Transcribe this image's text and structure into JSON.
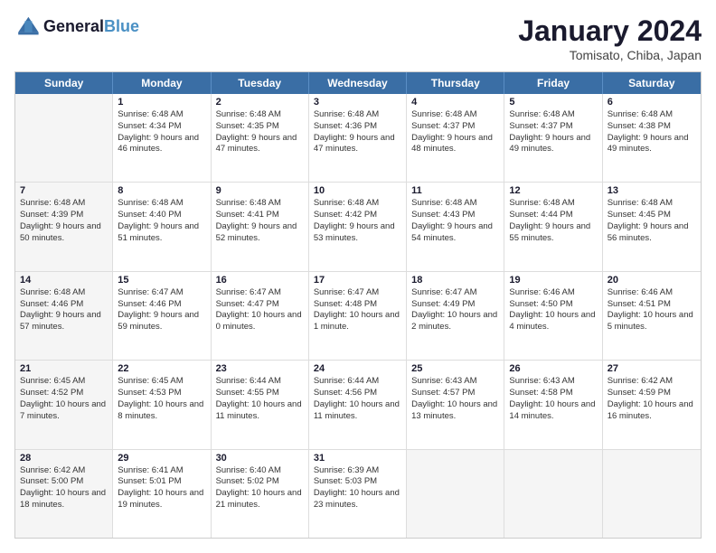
{
  "header": {
    "logo_line1": "General",
    "logo_line2": "Blue",
    "month_year": "January 2024",
    "location": "Tomisato, Chiba, Japan"
  },
  "days_of_week": [
    "Sunday",
    "Monday",
    "Tuesday",
    "Wednesday",
    "Thursday",
    "Friday",
    "Saturday"
  ],
  "weeks": [
    [
      {
        "day": "",
        "sunrise": "",
        "sunset": "",
        "daylight": "",
        "shaded": true
      },
      {
        "day": "1",
        "sunrise": "Sunrise: 6:48 AM",
        "sunset": "Sunset: 4:34 PM",
        "daylight": "Daylight: 9 hours and 46 minutes.",
        "shaded": false
      },
      {
        "day": "2",
        "sunrise": "Sunrise: 6:48 AM",
        "sunset": "Sunset: 4:35 PM",
        "daylight": "Daylight: 9 hours and 47 minutes.",
        "shaded": false
      },
      {
        "day": "3",
        "sunrise": "Sunrise: 6:48 AM",
        "sunset": "Sunset: 4:36 PM",
        "daylight": "Daylight: 9 hours and 47 minutes.",
        "shaded": false
      },
      {
        "day": "4",
        "sunrise": "Sunrise: 6:48 AM",
        "sunset": "Sunset: 4:37 PM",
        "daylight": "Daylight: 9 hours and 48 minutes.",
        "shaded": false
      },
      {
        "day": "5",
        "sunrise": "Sunrise: 6:48 AM",
        "sunset": "Sunset: 4:37 PM",
        "daylight": "Daylight: 9 hours and 49 minutes.",
        "shaded": false
      },
      {
        "day": "6",
        "sunrise": "Sunrise: 6:48 AM",
        "sunset": "Sunset: 4:38 PM",
        "daylight": "Daylight: 9 hours and 49 minutes.",
        "shaded": false
      }
    ],
    [
      {
        "day": "7",
        "sunrise": "Sunrise: 6:48 AM",
        "sunset": "Sunset: 4:39 PM",
        "daylight": "Daylight: 9 hours and 50 minutes.",
        "shaded": true
      },
      {
        "day": "8",
        "sunrise": "Sunrise: 6:48 AM",
        "sunset": "Sunset: 4:40 PM",
        "daylight": "Daylight: 9 hours and 51 minutes.",
        "shaded": false
      },
      {
        "day": "9",
        "sunrise": "Sunrise: 6:48 AM",
        "sunset": "Sunset: 4:41 PM",
        "daylight": "Daylight: 9 hours and 52 minutes.",
        "shaded": false
      },
      {
        "day": "10",
        "sunrise": "Sunrise: 6:48 AM",
        "sunset": "Sunset: 4:42 PM",
        "daylight": "Daylight: 9 hours and 53 minutes.",
        "shaded": false
      },
      {
        "day": "11",
        "sunrise": "Sunrise: 6:48 AM",
        "sunset": "Sunset: 4:43 PM",
        "daylight": "Daylight: 9 hours and 54 minutes.",
        "shaded": false
      },
      {
        "day": "12",
        "sunrise": "Sunrise: 6:48 AM",
        "sunset": "Sunset: 4:44 PM",
        "daylight": "Daylight: 9 hours and 55 minutes.",
        "shaded": false
      },
      {
        "day": "13",
        "sunrise": "Sunrise: 6:48 AM",
        "sunset": "Sunset: 4:45 PM",
        "daylight": "Daylight: 9 hours and 56 minutes.",
        "shaded": false
      }
    ],
    [
      {
        "day": "14",
        "sunrise": "Sunrise: 6:48 AM",
        "sunset": "Sunset: 4:46 PM",
        "daylight": "Daylight: 9 hours and 57 minutes.",
        "shaded": true
      },
      {
        "day": "15",
        "sunrise": "Sunrise: 6:47 AM",
        "sunset": "Sunset: 4:46 PM",
        "daylight": "Daylight: 9 hours and 59 minutes.",
        "shaded": false
      },
      {
        "day": "16",
        "sunrise": "Sunrise: 6:47 AM",
        "sunset": "Sunset: 4:47 PM",
        "daylight": "Daylight: 10 hours and 0 minutes.",
        "shaded": false
      },
      {
        "day": "17",
        "sunrise": "Sunrise: 6:47 AM",
        "sunset": "Sunset: 4:48 PM",
        "daylight": "Daylight: 10 hours and 1 minute.",
        "shaded": false
      },
      {
        "day": "18",
        "sunrise": "Sunrise: 6:47 AM",
        "sunset": "Sunset: 4:49 PM",
        "daylight": "Daylight: 10 hours and 2 minutes.",
        "shaded": false
      },
      {
        "day": "19",
        "sunrise": "Sunrise: 6:46 AM",
        "sunset": "Sunset: 4:50 PM",
        "daylight": "Daylight: 10 hours and 4 minutes.",
        "shaded": false
      },
      {
        "day": "20",
        "sunrise": "Sunrise: 6:46 AM",
        "sunset": "Sunset: 4:51 PM",
        "daylight": "Daylight: 10 hours and 5 minutes.",
        "shaded": false
      }
    ],
    [
      {
        "day": "21",
        "sunrise": "Sunrise: 6:45 AM",
        "sunset": "Sunset: 4:52 PM",
        "daylight": "Daylight: 10 hours and 7 minutes.",
        "shaded": true
      },
      {
        "day": "22",
        "sunrise": "Sunrise: 6:45 AM",
        "sunset": "Sunset: 4:53 PM",
        "daylight": "Daylight: 10 hours and 8 minutes.",
        "shaded": false
      },
      {
        "day": "23",
        "sunrise": "Sunrise: 6:44 AM",
        "sunset": "Sunset: 4:55 PM",
        "daylight": "Daylight: 10 hours and 11 minutes.",
        "shaded": false
      },
      {
        "day": "24",
        "sunrise": "Sunrise: 6:44 AM",
        "sunset": "Sunset: 4:56 PM",
        "daylight": "Daylight: 10 hours and 11 minutes.",
        "shaded": false
      },
      {
        "day": "25",
        "sunrise": "Sunrise: 6:43 AM",
        "sunset": "Sunset: 4:57 PM",
        "daylight": "Daylight: 10 hours and 13 minutes.",
        "shaded": false
      },
      {
        "day": "26",
        "sunrise": "Sunrise: 6:43 AM",
        "sunset": "Sunset: 4:58 PM",
        "daylight": "Daylight: 10 hours and 14 minutes.",
        "shaded": false
      },
      {
        "day": "27",
        "sunrise": "Sunrise: 6:42 AM",
        "sunset": "Sunset: 4:59 PM",
        "daylight": "Daylight: 10 hours and 16 minutes.",
        "shaded": false
      }
    ],
    [
      {
        "day": "28",
        "sunrise": "Sunrise: 6:42 AM",
        "sunset": "Sunset: 5:00 PM",
        "daylight": "Daylight: 10 hours and 18 minutes.",
        "shaded": true
      },
      {
        "day": "29",
        "sunrise": "Sunrise: 6:41 AM",
        "sunset": "Sunset: 5:01 PM",
        "daylight": "Daylight: 10 hours and 19 minutes.",
        "shaded": false
      },
      {
        "day": "30",
        "sunrise": "Sunrise: 6:40 AM",
        "sunset": "Sunset: 5:02 PM",
        "daylight": "Daylight: 10 hours and 21 minutes.",
        "shaded": false
      },
      {
        "day": "31",
        "sunrise": "Sunrise: 6:39 AM",
        "sunset": "Sunset: 5:03 PM",
        "daylight": "Daylight: 10 hours and 23 minutes.",
        "shaded": false
      },
      {
        "day": "",
        "sunrise": "",
        "sunset": "",
        "daylight": "",
        "shaded": true
      },
      {
        "day": "",
        "sunrise": "",
        "sunset": "",
        "daylight": "",
        "shaded": true
      },
      {
        "day": "",
        "sunrise": "",
        "sunset": "",
        "daylight": "",
        "shaded": true
      }
    ]
  ]
}
